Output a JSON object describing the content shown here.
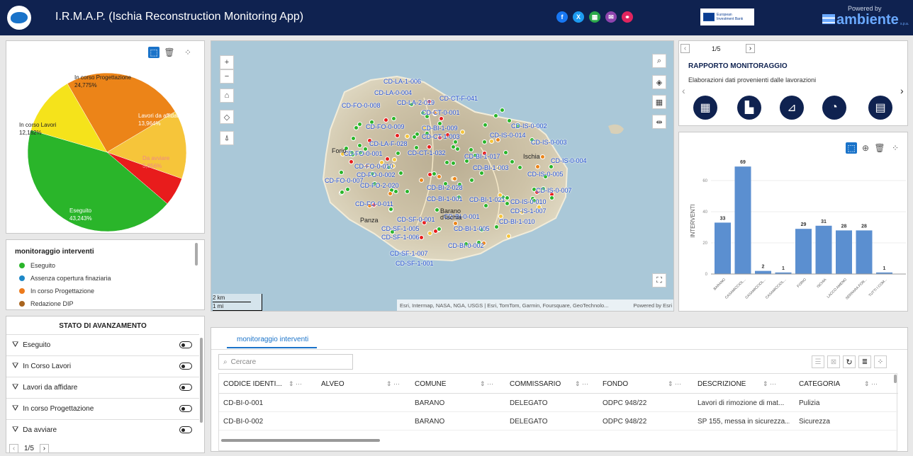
{
  "header": {
    "title": "I.R.M.A.P. (Ischia Reconstruction Monitoring App)",
    "eib_line1": "European",
    "eib_line2": "Investment Bank",
    "powered_by": "Powered by",
    "brand": "ambiente",
    "brand_suffix": "s.p.a."
  },
  "social": [
    {
      "icon": "facebook-icon",
      "color": "#1877f2",
      "glyph": "f"
    },
    {
      "icon": "x-icon",
      "color": "#1d9bf0",
      "glyph": "X"
    },
    {
      "icon": "app-icon",
      "color": "#2aa84a",
      "glyph": "▦"
    },
    {
      "icon": "mail-icon",
      "color": "#8e44ad",
      "glyph": "✉"
    },
    {
      "icon": "link-icon",
      "color": "#e0245e",
      "glyph": "⚭"
    }
  ],
  "chart_data": [
    {
      "type": "pie",
      "series": [
        {
          "name": "Eseguito",
          "value": 43.243,
          "label": "43,243%",
          "color": "#2ab52a"
        },
        {
          "name": "In corso Lavori",
          "value": 12.162,
          "label": "12,162%",
          "color": "#f5e31b"
        },
        {
          "name": "In corso Progettazione",
          "value": 24.775,
          "label": "24,775%",
          "color": "#ec8418"
        },
        {
          "name": "Lavori da affidare",
          "value": 13.964,
          "label": "13,964%",
          "color": "#f6c53a"
        },
        {
          "name": "Da avviare",
          "value": 5.856,
          "label": "5,856%",
          "color": "#e81c1c"
        }
      ]
    },
    {
      "type": "bar",
      "ylabel": "INTERVENTI",
      "ylim": [
        0,
        75
      ],
      "yticks": [
        0,
        20,
        40,
        60
      ],
      "categories": [
        "BARANO",
        "CASAMICCIOL...",
        "CASAMICCIOL...",
        "CASAMICCIOL...",
        "FORIO",
        "ISCHIA",
        "LACCO AMENO",
        "SERRARA FON...",
        "TUTTI I COM..."
      ],
      "values": [
        33,
        69,
        2,
        1,
        29,
        31,
        28,
        28,
        1
      ],
      "color": "#5b8fd0"
    }
  ],
  "pie_labels": {
    "prog": "In corso Progettazione",
    "lavori": "In corso Lavori",
    "affidare": "Lavori da affidare",
    "avviare": "Da avviare",
    "eseguito": "Eseguito"
  },
  "legend": {
    "title": "monitoraggio interventi",
    "items": [
      {
        "label": "Eseguito",
        "color": "#2ab52a"
      },
      {
        "label": "Assenza copertura finaziaria",
        "color": "#1e88c7"
      },
      {
        "label": "In corso Progettazione",
        "color": "#ec7a1c"
      },
      {
        "label": "Redazione DIP",
        "color": "#a8641e"
      }
    ]
  },
  "filters": {
    "title": "STATO DI AVANZAMENTO",
    "items": [
      "Eseguito",
      "In Corso Lavori",
      "Lavori da affidare",
      "In corso Progettazione",
      "Da avviare"
    ],
    "page": "1/5"
  },
  "map": {
    "attribution": "Esri, Intermap, NASA, NGA, USGS | Esri, TomTom, Garmin, Foursquare, GeoTechnolo...",
    "powered": "Powered by Esri",
    "scale_km": "2 km",
    "scale_mi": "1 mi",
    "places": [
      "Forio",
      "Ischia",
      "Barano d'Ischia",
      "Panza"
    ],
    "labels": [
      "CD-LA-1-006",
      "CD-LA-0-004",
      "CD-LA-2-019",
      "CD-CT-F-041",
      "CD-FO-0-008",
      "CD-CT-0-001",
      "CD-FO-0-009",
      "CD-BI-1-009",
      "CD-IS-0-002",
      "CD-IS-0-014",
      "CD-CT-1-003",
      "CD-IS-0-003",
      "CD-LA-F-028",
      "CD-CT-1-032",
      "CD-FO-0-001",
      "CD-BI-1-017",
      "CD-IS-0-004",
      "CD-BI-1-003",
      "CD-FO-0-010",
      "CD-FO-0-002",
      "CD-IS-0-005",
      "CD-FO-0-007",
      "CD-FO-2-020",
      "CD-BI-2-028",
      "CD-IS-0-007",
      "CD-BI-1-001",
      "CD-BI-1-021",
      "CD-IS-0-010",
      "CD-FO-0-011",
      "CD-IS-1-007",
      "CD-SF-0-001",
      "CD-BI-0-001",
      "CD-BI-1-010",
      "CD-SF-1-005",
      "CD-BI-1-005",
      "CD-SF-1-006",
      "CD-BI-0-002",
      "CD-SF-1-007",
      "CD-SF-1-001"
    ]
  },
  "report": {
    "page": "1/5",
    "title": "RAPPORTO MONITORAGGIO",
    "subtitle": "Elaborazioni dati provenienti dalle lavorazioni"
  },
  "table": {
    "tab": "monitoraggio interventi",
    "search_placeholder": "Cercare",
    "columns": [
      "CODICE IDENTI...",
      "ALVEO",
      "COMUNE",
      "COMMISSARIO",
      "FONDO",
      "DESCRIZIONE",
      "CATEGORIA"
    ],
    "rows": [
      [
        "CD-BI-0-001",
        "",
        "BARANO",
        "DELEGATO",
        "ODPC 948/22",
        "Lavori di rimozione di mat...",
        "Pulizia"
      ],
      [
        "CD-BI-0-002",
        "",
        "BARANO",
        "DELEGATO",
        "ODPC 948/22",
        "SP 155, messa in sicurezza...",
        "Sicurezza"
      ]
    ]
  }
}
